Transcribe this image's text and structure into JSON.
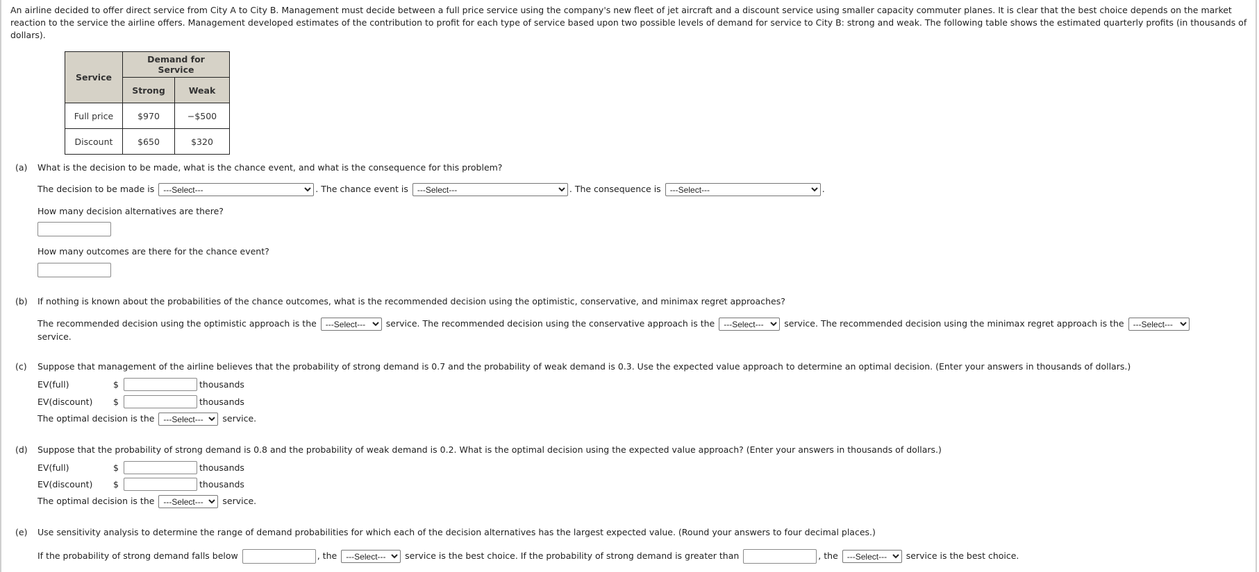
{
  "intro": "An airline decided to offer direct service from City A to City B. Management must decide between a full price service using the company's new fleet of jet aircraft and a discount service using smaller capacity commuter planes. It is clear that the best choice depends on the market reaction to the service the airline offers. Management developed estimates of the contribution to profit for each type of service based upon two possible levels of demand for service to City B: strong and weak. The following table shows the estimated quarterly profits (in thousands of dollars).",
  "table": {
    "row_header": "Service",
    "group_header": "Demand for Service",
    "columns": [
      "Strong",
      "Weak"
    ],
    "rows": [
      {
        "label": "Full price",
        "values": [
          "$970",
          "−$500"
        ]
      },
      {
        "label": "Discount",
        "values": [
          "$650",
          "$320"
        ]
      }
    ]
  },
  "select_placeholder": "---Select---",
  "part_a": {
    "letter": "(a)",
    "question": "What is the decision to be made, what is the chance event, and what is the consequence for this problem?",
    "decision_prefix": "The decision to be made is",
    "chance_prefix": ". The chance event is",
    "consequence_prefix": ". The consequence is",
    "end": ".",
    "alternatives_q": "How many decision alternatives are there?",
    "alternatives_value": "",
    "outcomes_q": "How many outcomes are there for the chance event?",
    "outcomes_value": ""
  },
  "part_b": {
    "letter": "(b)",
    "question": "If nothing is known about the probabilities of the chance outcomes, what is the recommended decision using the optimistic, conservative, and minimax regret approaches?",
    "optimistic_prefix": "The recommended decision using the optimistic approach is the",
    "conservative_prefix": "service. The recommended decision using the conservative approach is the",
    "minimax_prefix": "service. The recommended decision using the minimax regret approach is the",
    "end": "service."
  },
  "part_c": {
    "letter": "(c)",
    "question": "Suppose that management of the airline believes that the probability of strong demand is 0.7 and the probability of weak demand is 0.3. Use the expected value approach to determine an optimal decision. (Enter your answers in thousands of dollars.)",
    "ev_full_label": "EV(full)",
    "ev_discount_label": "EV(discount)",
    "currency": "$",
    "unit": "thousands",
    "ev_full_value": "",
    "ev_discount_value": "",
    "optimal_prefix": "The optimal decision is the",
    "optimal_suffix": "service."
  },
  "part_d": {
    "letter": "(d)",
    "question": "Suppose that the probability of strong demand is 0.8 and the probability of weak demand is 0.2. What is the optimal decision using the expected value approach? (Enter your answers in thousands of dollars.)",
    "ev_full_label": "EV(full)",
    "ev_discount_label": "EV(discount)",
    "currency": "$",
    "unit": "thousands",
    "ev_full_value": "",
    "ev_discount_value": "",
    "optimal_prefix": "The optimal decision is the",
    "optimal_suffix": "service."
  },
  "part_e": {
    "letter": "(e)",
    "question": "Use sensitivity analysis to determine the range of demand probabilities for which each of the decision alternatives has the largest expected value. (Round your answers to four decimal places.)",
    "below_prefix": "If the probability of strong demand falls below",
    "the1": ", the",
    "mid": "service is the best choice. If the probability of strong demand is greater than",
    "the2": ", the",
    "end": "service is the best choice.",
    "below_value": "",
    "above_value": ""
  }
}
